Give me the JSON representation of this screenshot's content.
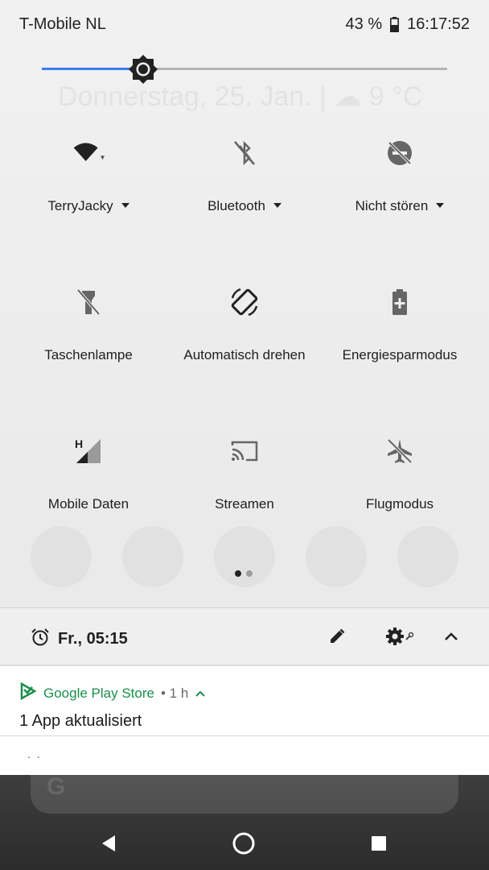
{
  "status_bar": {
    "carrier": "T-Mobile NL",
    "battery": "43 %",
    "time": "16:17:52"
  },
  "brightness": {
    "level": 0.25
  },
  "background_ghost": {
    "date_weather": "Donnerstag, 25. Jan. | ☁ 9 °C"
  },
  "tiles": [
    {
      "label": "TerryJacky",
      "icon": "wifi-icon",
      "has_dropdown": true
    },
    {
      "label": "Bluetooth",
      "icon": "bluetooth-off-icon",
      "has_dropdown": true
    },
    {
      "label": "Nicht stören",
      "icon": "do-not-disturb-off-icon",
      "has_dropdown": true
    },
    {
      "label": "Taschenlampe",
      "icon": "flashlight-off-icon",
      "has_dropdown": false
    },
    {
      "label": "Automatisch drehen",
      "icon": "auto-rotate-icon",
      "has_dropdown": false
    },
    {
      "label": "Energiesparmodus",
      "icon": "battery-saver-icon",
      "has_dropdown": false
    },
    {
      "label": "Mobile Daten",
      "icon": "mobile-data-icon",
      "has_dropdown": false
    },
    {
      "label": "Streamen",
      "icon": "cast-icon",
      "has_dropdown": false
    },
    {
      "label": "Flugmodus",
      "icon": "airplane-mode-off-icon",
      "has_dropdown": false
    }
  ],
  "page_dots": {
    "count": 2,
    "active": 0
  },
  "footer": {
    "alarm": "Fr., 05:15"
  },
  "notification": {
    "app": "Google Play Store",
    "meta": "• 1 h",
    "title": "1 App aktualisiert",
    "more": ". ."
  },
  "colors": {
    "accent": "#3a7cf0",
    "play_green": "#1a8f4c"
  }
}
